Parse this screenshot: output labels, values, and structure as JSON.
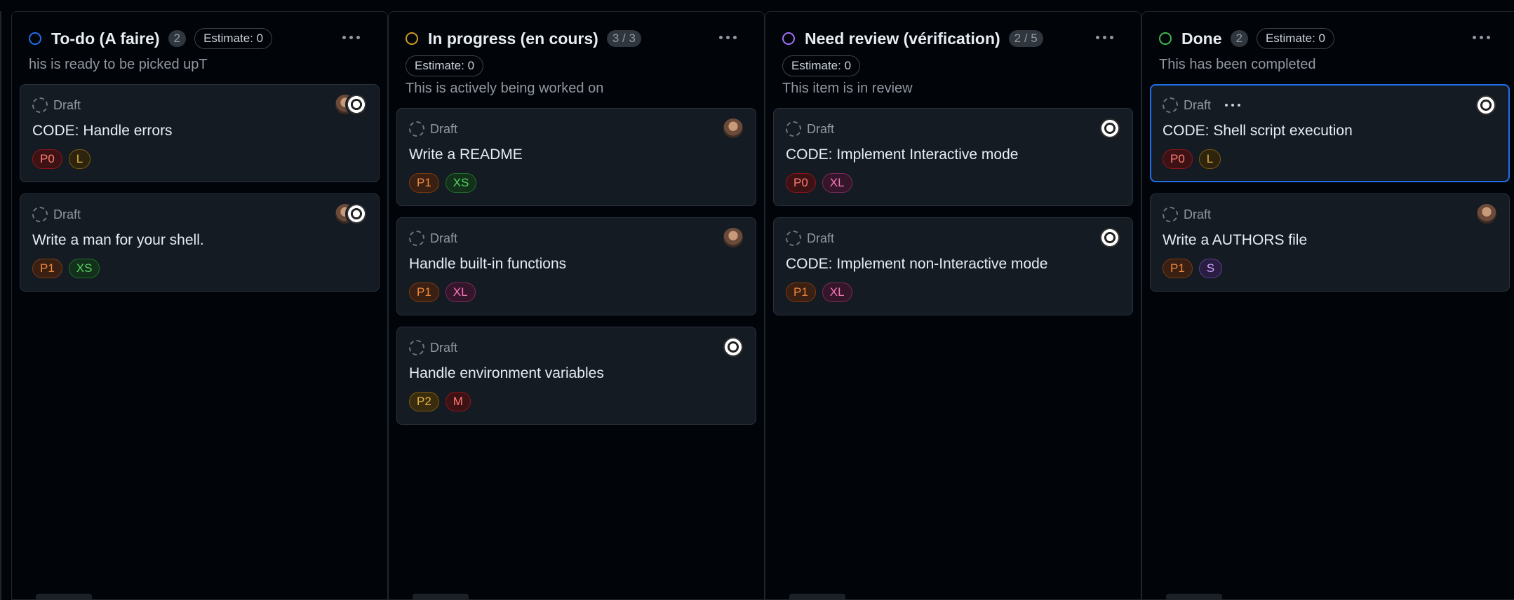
{
  "columns": [
    {
      "title": "To-do (A faire)",
      "count": "2",
      "estimate": "Estimate: 0",
      "description": "his is ready to be picked upT",
      "status_color": "#1f6feb",
      "cards": [
        {
          "status": "Draft",
          "title": "CODE: Handle errors",
          "labels": [
            "P0",
            "L"
          ],
          "avatars": [
            "brown",
            "bw"
          ]
        },
        {
          "status": "Draft",
          "title": "Write a man for your shell.",
          "labels": [
            "P1",
            "XS"
          ],
          "avatars": [
            "brown",
            "bw"
          ]
        }
      ]
    },
    {
      "title": "In progress (en cours)",
      "count": "3 / 3",
      "estimate": "Estimate: 0",
      "description": "This is actively being worked on",
      "status_color": "#d29922",
      "cards": [
        {
          "status": "Draft",
          "title": "Write a README",
          "labels": [
            "P1",
            "XS"
          ],
          "avatars": [
            "brown"
          ]
        },
        {
          "status": "Draft",
          "title": "Handle built-in functions",
          "labels": [
            "P1",
            "XL"
          ],
          "avatars": [
            "brown"
          ]
        },
        {
          "status": "Draft",
          "title": "Handle environment variables",
          "labels": [
            "P2",
            "M"
          ],
          "avatars": [
            "bw"
          ]
        }
      ]
    },
    {
      "title": "Need review (vérification)",
      "count": "2 / 5",
      "estimate": "Estimate: 0",
      "description": "This item is in review",
      "status_color": "#a371f7",
      "cards": [
        {
          "status": "Draft",
          "title": "CODE: Implement Interactive mode",
          "labels": [
            "P0",
            "XL"
          ],
          "avatars": [
            "bw"
          ]
        },
        {
          "status": "Draft",
          "title": "CODE: Implement non-Interactive mode",
          "labels": [
            "P1",
            "XL"
          ],
          "avatars": [
            "bw"
          ]
        }
      ]
    },
    {
      "title": "Done",
      "count": "2",
      "estimate": "Estimate: 0",
      "description": "This has been completed",
      "status_color": "#3fb950",
      "cards": [
        {
          "status": "Draft",
          "title": "CODE: Shell script execution",
          "labels": [
            "P0",
            "L"
          ],
          "avatars": [
            "bw"
          ],
          "selected": true
        },
        {
          "status": "Draft",
          "title": "Write a AUTHORS file",
          "labels": [
            "P1",
            "S"
          ],
          "avatars": [
            "brown"
          ]
        }
      ]
    }
  ]
}
